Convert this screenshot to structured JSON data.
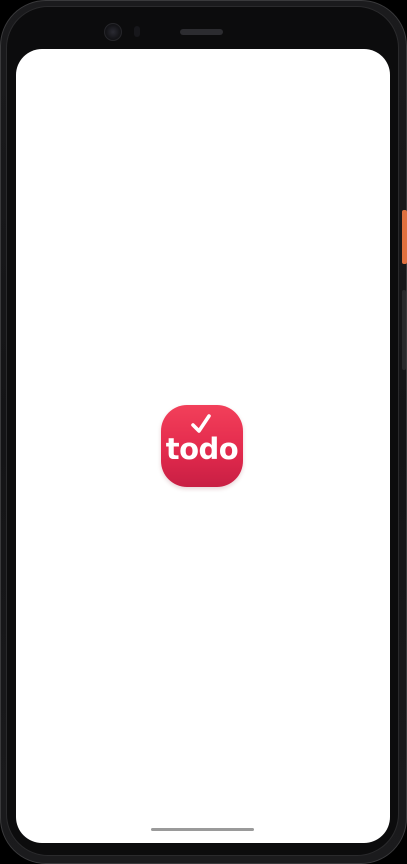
{
  "device": {
    "accent_button_color": "#e0703f",
    "frame_color": "#1b1b1d"
  },
  "splash": {
    "app_icon": {
      "label": "todo",
      "check_icon": "check-mark-icon",
      "gradient_top": "#f2405a",
      "gradient_bottom": "#c81f44"
    },
    "background_color": "#ffffff"
  }
}
